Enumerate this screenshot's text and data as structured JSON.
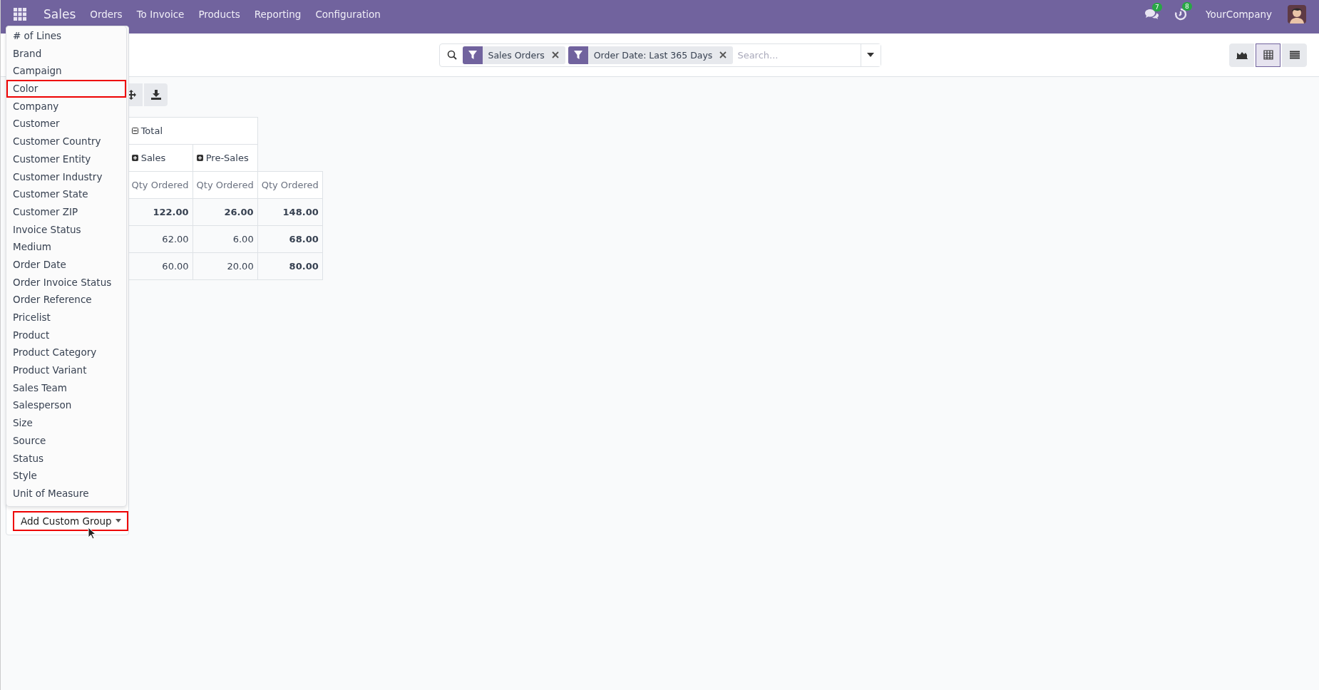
{
  "navbar": {
    "app_name": "Sales",
    "menu": [
      "Orders",
      "To Invoice",
      "Products",
      "Reporting",
      "Configuration"
    ],
    "messages_count": "7",
    "activities_count": "8",
    "company": "YourCompany"
  },
  "search": {
    "facets": [
      {
        "label": "Sales Orders"
      },
      {
        "label": "Order Date: Last 365 Days"
      }
    ],
    "placeholder": "Search..."
  },
  "views": [
    {
      "kind": "graph",
      "selected": false
    },
    {
      "kind": "pivot",
      "selected": true
    },
    {
      "kind": "list",
      "selected": false
    }
  ],
  "pivot": {
    "column_total": {
      "label": "Total",
      "expanded": true
    },
    "column_groups": [
      {
        "label": "Sales",
        "expanded": false
      },
      {
        "label": "Pre-Sales",
        "expanded": false
      }
    ],
    "measures": [
      "Qty Ordered",
      "Qty Ordered",
      "Qty Ordered"
    ],
    "rows": [
      {
        "kind": "total",
        "values": [
          "122.00",
          "26.00",
          "148.00"
        ]
      },
      {
        "kind": "group",
        "values": [
          "62.00",
          "6.00",
          "68.00"
        ]
      },
      {
        "kind": "group",
        "values": [
          "60.00",
          "20.00",
          "80.00"
        ]
      }
    ]
  },
  "group_by_menu": {
    "items": [
      {
        "label": "# of Lines",
        "marked": false
      },
      {
        "label": "Brand",
        "marked": false
      },
      {
        "label": "Campaign",
        "marked": false
      },
      {
        "label": "Color",
        "marked": true
      },
      {
        "label": "Company",
        "marked": false
      },
      {
        "label": "Customer",
        "marked": false
      },
      {
        "label": "Customer Country",
        "marked": false
      },
      {
        "label": "Customer Entity",
        "marked": false
      },
      {
        "label": "Customer Industry",
        "marked": false
      },
      {
        "label": "Customer State",
        "marked": false
      },
      {
        "label": "Customer ZIP",
        "marked": false
      },
      {
        "label": "Invoice Status",
        "marked": false
      },
      {
        "label": "Medium",
        "marked": false
      },
      {
        "label": "Order Date",
        "marked": false
      },
      {
        "label": "Order Invoice Status",
        "marked": false
      },
      {
        "label": "Order Reference",
        "marked": false
      },
      {
        "label": "Pricelist",
        "marked": false
      },
      {
        "label": "Product",
        "marked": false
      },
      {
        "label": "Product Category",
        "marked": false
      },
      {
        "label": "Product Variant",
        "marked": false
      },
      {
        "label": "Sales Team",
        "marked": false
      },
      {
        "label": "Salesperson",
        "marked": false
      },
      {
        "label": "Size",
        "marked": false
      },
      {
        "label": "Source",
        "marked": false
      },
      {
        "label": "Status",
        "marked": false
      },
      {
        "label": "Style",
        "marked": false
      },
      {
        "label": "Unit of Measure",
        "marked": false
      }
    ],
    "custom_group": {
      "label": "Add Custom Group",
      "marked": true
    }
  }
}
